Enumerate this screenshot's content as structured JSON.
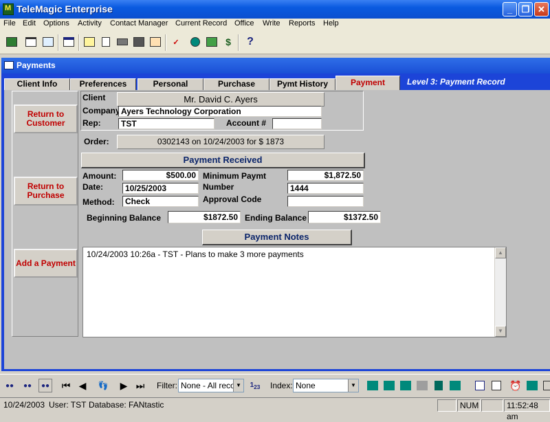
{
  "window": {
    "title": "TeleMagic Enterprise"
  },
  "menu": [
    "File",
    "Edit",
    "Options",
    "Activity",
    "Contact Manager",
    "Current Record",
    "Office",
    "Write",
    "Reports",
    "Help"
  ],
  "toolbar_icons": [
    "address-book-icon",
    "list-icon",
    "card-icon",
    "calendar-icon",
    "notes-icon",
    "document-icon",
    "printer-icon",
    "fax-icon",
    "letter-icon",
    "spell-check-icon",
    "search-icon",
    "phone-icon",
    "dollar-icon",
    "help-icon"
  ],
  "child": {
    "title": "Payments",
    "level": "Level 3: Payment Record"
  },
  "tabs": [
    "Client Info",
    "Preferences",
    "Personal",
    "Purchase",
    "Pymt History",
    "Payment"
  ],
  "nav_buttons": {
    "return_customer": "Return to Customer",
    "return_purchase": "Return to Purchase",
    "add_payment": "Add a Payment"
  },
  "client": {
    "client_label": "Client",
    "client_value": "Mr. David C. Ayers",
    "company_label": "Company",
    "company_value": "Ayers Technology Corporation",
    "rep_label": "Rep:",
    "rep_value": "TST",
    "account_label": "Account #",
    "account_value": ""
  },
  "order": {
    "label": "Order:",
    "value": "0302143 on 10/24/2003 for $     1873"
  },
  "payment": {
    "header": "Payment Received",
    "amount_label": "Amount:",
    "amount_value": "$500.00",
    "date_label": "Date:",
    "date_value": "10/25/2003",
    "method_label": "Method:",
    "method_value": "Check",
    "min_label": "Minimum Paymt",
    "min_value": "$1,872.50",
    "number_label": "Number",
    "number_value": "1444",
    "approval_label": "Approval Code",
    "approval_value": "",
    "beginning_label": "Beginning Balance",
    "beginning_value": "$1872.50",
    "ending_label": "Ending Balance",
    "ending_value": "$1372.50"
  },
  "notes": {
    "header": "Payment Notes",
    "text": "10/24/2003 10:26a - TST - Plans to make 3 more payments"
  },
  "navbar": {
    "filter_label": "Filter:",
    "filter_value": "None - All recor",
    "index_label": "Index:",
    "index_value": "None"
  },
  "status": {
    "date": "10/24/2003",
    "user": "User: TST",
    "database": "Database: FANtastic",
    "num": "NUM",
    "time": "11:52:48 am"
  },
  "colors": {
    "title_blue": "#0a5ae0",
    "child_blue": "#1c44d8",
    "accent_red": "#c00000",
    "header_navy": "#0a246a"
  }
}
